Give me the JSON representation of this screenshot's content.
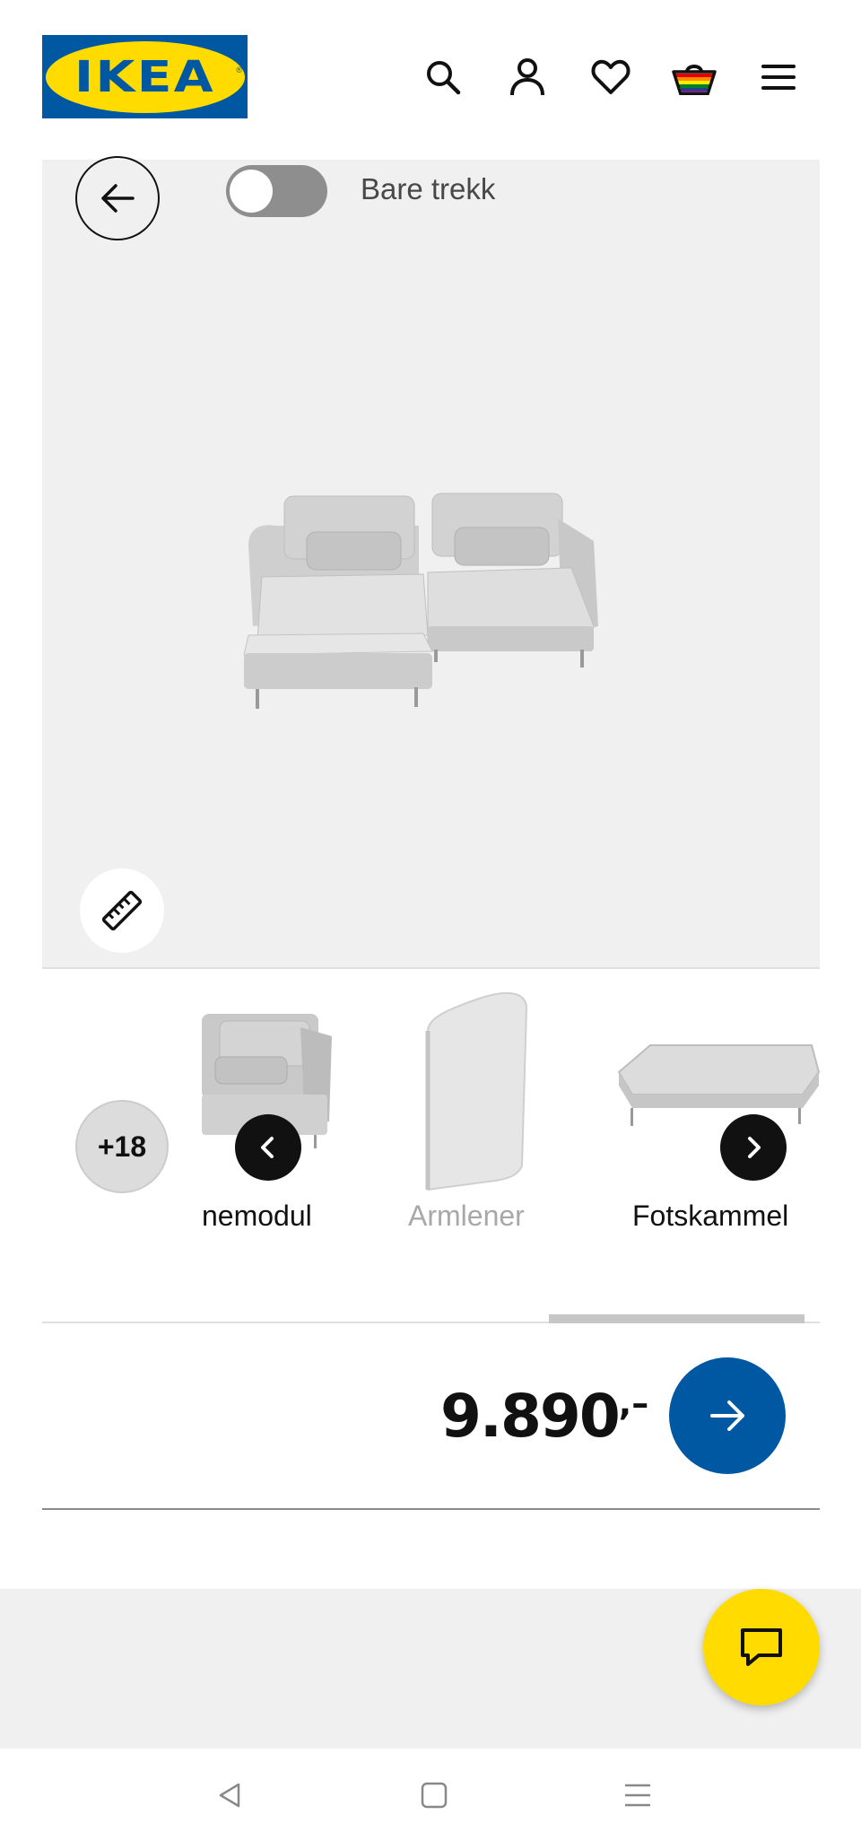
{
  "header": {
    "logo_text": "IKEA",
    "logo_reg": "®",
    "icons": [
      "search-icon",
      "profile-icon",
      "heart-icon",
      "cart-icon",
      "menu-icon"
    ]
  },
  "viewer": {
    "toggle_label": "Bare trekk",
    "toggle_on": false
  },
  "carousel": {
    "more_count": "+18",
    "items": [
      {
        "label": "nemodul",
        "muted": false
      },
      {
        "label": "Armlener",
        "muted": true
      },
      {
        "label": "Fotskammel",
        "muted": false
      }
    ]
  },
  "price": {
    "amount": "9.890",
    "suffix": ",–"
  },
  "colors": {
    "ikea_blue": "#0058a3",
    "ikea_yellow": "#ffdb00",
    "viewer_bg": "#f0f0f0"
  }
}
